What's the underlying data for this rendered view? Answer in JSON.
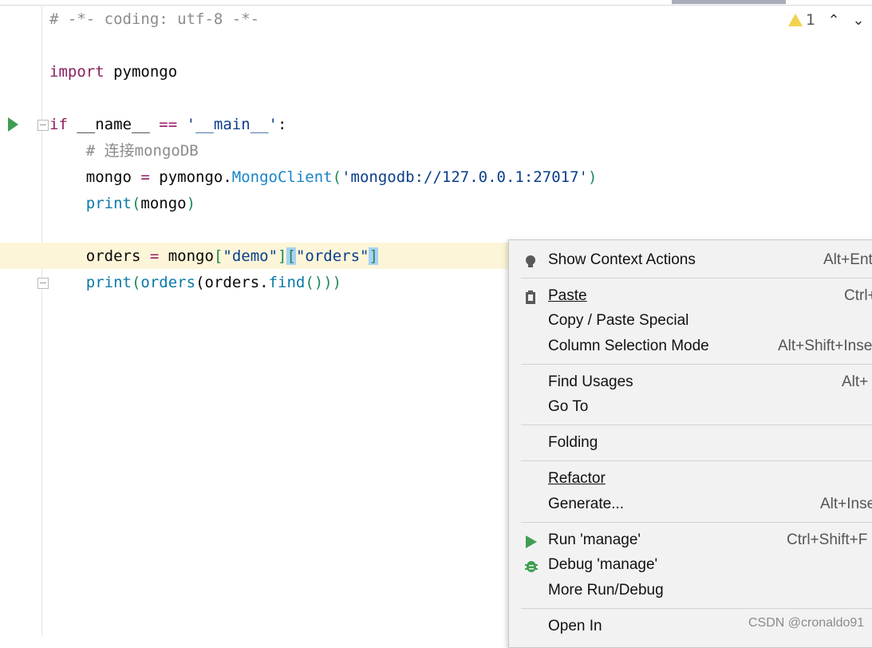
{
  "editor": {
    "lines": [
      {
        "tokens": [
          {
            "t": "# -*- coding: utf-8 -*-",
            "c": "cm"
          }
        ]
      },
      {
        "tokens": []
      },
      {
        "tokens": [
          {
            "t": "import",
            "c": "kw2"
          },
          {
            "t": " pymongo",
            "c": ""
          }
        ]
      },
      {
        "tokens": []
      },
      {
        "tokens": [
          {
            "t": "if",
            "c": "kw2"
          },
          {
            "t": " __name__ ",
            "c": ""
          },
          {
            "t": "==",
            "c": "op"
          },
          {
            "t": " '__main__'",
            "c": "st2"
          },
          {
            "t": ":",
            "c": ""
          }
        ]
      },
      {
        "tokens": [
          {
            "t": "    # 连接mongoDB",
            "c": "cm"
          }
        ]
      },
      {
        "tokens": [
          {
            "t": "    mongo ",
            "c": ""
          },
          {
            "t": "=",
            "c": "op"
          },
          {
            "t": " pymongo.",
            "c": ""
          },
          {
            "t": "MongoClient",
            "c": "cls"
          },
          {
            "t": "(",
            "c": "br"
          },
          {
            "t": "'mongodb://127.0.0.1:27017'",
            "c": "st2"
          },
          {
            "t": ")",
            "c": "br"
          }
        ]
      },
      {
        "tokens": [
          {
            "t": "    ",
            "c": ""
          },
          {
            "t": "print",
            "c": "fn"
          },
          {
            "t": "(",
            "c": "br"
          },
          {
            "t": "mongo",
            "c": ""
          },
          {
            "t": ")",
            "c": "br"
          }
        ]
      },
      {
        "tokens": []
      },
      {
        "tokens": [
          {
            "t": "    orders ",
            "c": ""
          },
          {
            "t": "=",
            "c": "op"
          },
          {
            "t": " mongo",
            "c": ""
          },
          {
            "t": "[",
            "c": "br"
          },
          {
            "t": "\"demo\"",
            "c": "st2"
          },
          {
            "t": "]",
            "c": "br"
          },
          {
            "t": "[",
            "c": "br brh"
          },
          {
            "t": "\"orders\"",
            "c": "st2"
          },
          {
            "t": "]",
            "c": "br brh"
          }
        ]
      },
      {
        "tokens": [
          {
            "t": "    ",
            "c": ""
          },
          {
            "t": "print",
            "c": "fn"
          },
          {
            "t": "(",
            "c": "br"
          },
          {
            "t": "orders",
            "c": "fn"
          },
          {
            "t": "(",
            "c": ""
          },
          {
            "t": "orders.",
            "c": ""
          },
          {
            "t": "find",
            "c": "fn"
          },
          {
            "t": "()))",
            "c": "br"
          }
        ]
      }
    ]
  },
  "inspection": {
    "count": "1"
  },
  "context_menu": {
    "items": [
      {
        "label": "Show Context Actions",
        "shortcut": "Alt+Ent",
        "icon": "lightbulb-icon"
      },
      {
        "label": "Paste",
        "shortcut": "Ctrl+",
        "icon": "clipboard-icon"
      },
      {
        "label": "Copy / Paste Special",
        "shortcut": "",
        "icon": ""
      },
      {
        "label": "Column Selection Mode",
        "shortcut": "Alt+Shift+Inse",
        "icon": ""
      },
      {
        "label": "Find Usages",
        "shortcut": "Alt+",
        "icon": ""
      },
      {
        "label": "Go To",
        "shortcut": "",
        "icon": ""
      },
      {
        "label": "Folding",
        "shortcut": "",
        "icon": ""
      },
      {
        "label": "Refactor",
        "shortcut": "",
        "icon": ""
      },
      {
        "label": "Generate...",
        "shortcut": "Alt+Inse",
        "icon": ""
      },
      {
        "label": "Run 'manage'",
        "shortcut": "Ctrl+Shift+F",
        "icon": "run-icon"
      },
      {
        "label": "Debug 'manage'",
        "shortcut": "",
        "icon": "debug-icon"
      },
      {
        "label": "More Run/Debug",
        "shortcut": "",
        "icon": ""
      },
      {
        "label": "Open In",
        "shortcut": "",
        "icon": ""
      }
    ]
  },
  "watermark": "CSDN @cronaldo91"
}
